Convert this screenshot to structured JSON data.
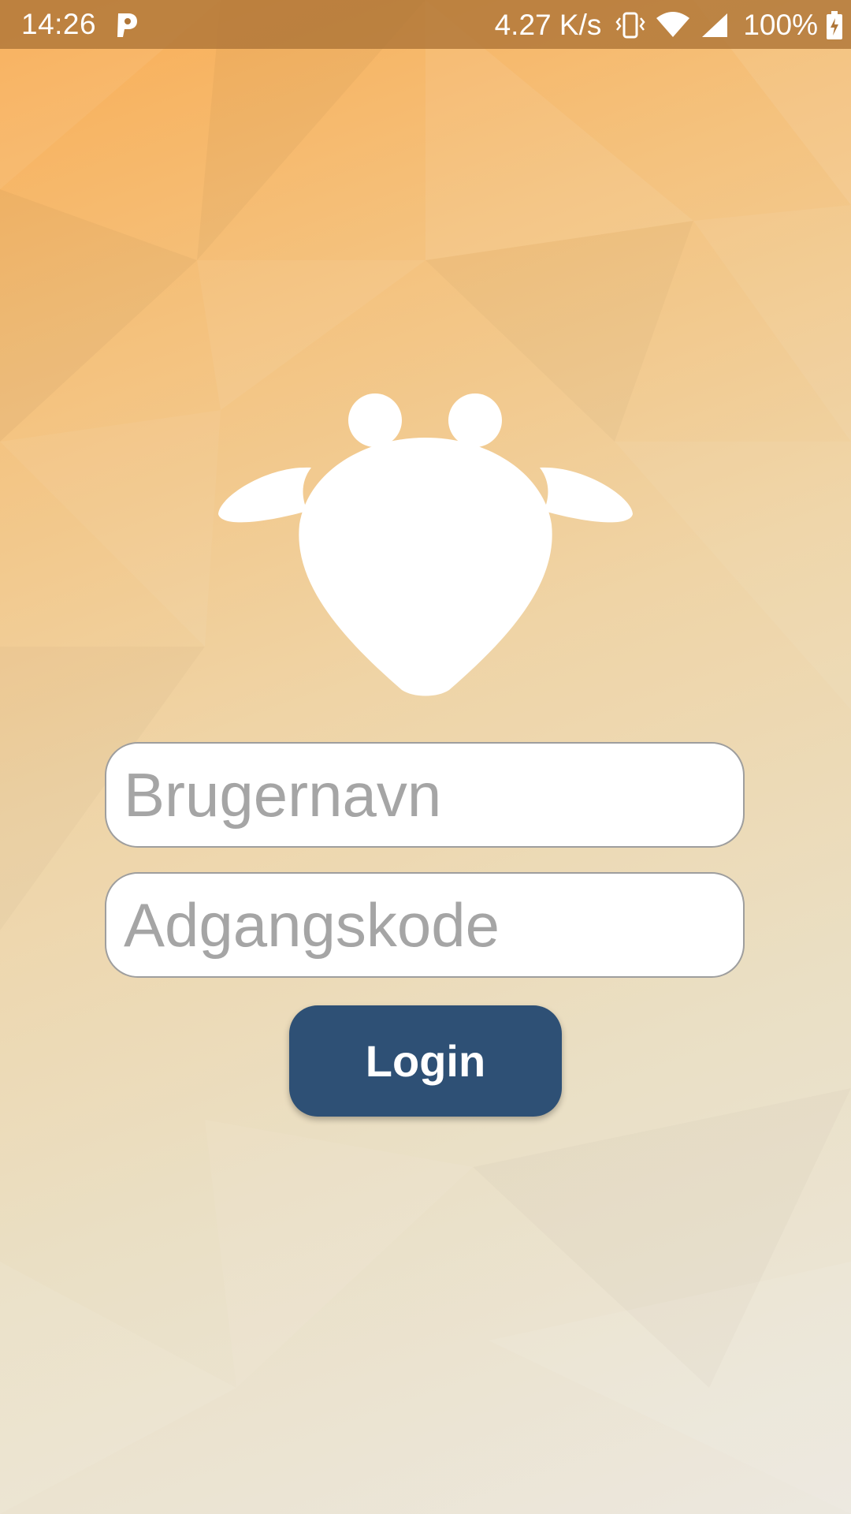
{
  "status_bar": {
    "time": "14:26",
    "net_speed": "4.27 K/s",
    "battery_percent": "100%",
    "icons": [
      "parking-app-icon",
      "vibrate-icon",
      "wifi-icon",
      "cell-signal-icon",
      "battery-charging-icon"
    ]
  },
  "logo": {
    "icon": "cow-head-logo",
    "color": "#ffffff"
  },
  "login_form": {
    "username_placeholder": "Brugernavn",
    "username_value": "",
    "password_placeholder": "Adgangskode",
    "password_value": "",
    "login_label": "Login"
  },
  "colors": {
    "button": "#2e5075",
    "status_bar": "#b07638",
    "background_top": "#f9ad55",
    "background_bottom": "#ece8df"
  }
}
